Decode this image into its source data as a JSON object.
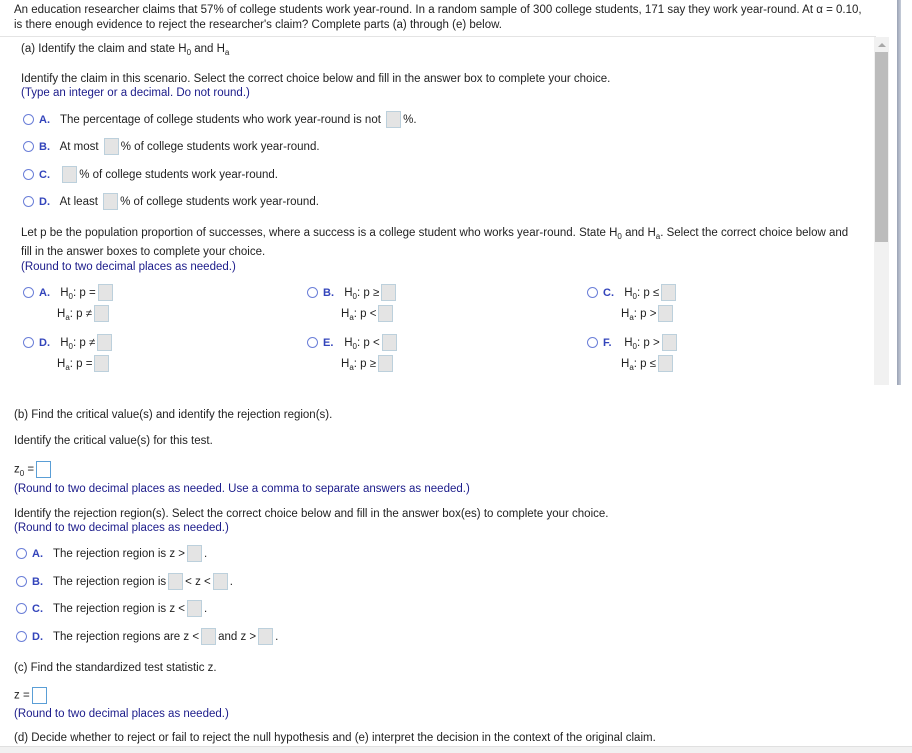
{
  "question": {
    "text": "An education researcher claims that 57% of college students work year-round. In a random sample of 300 college students, 171 say they work year-round. At α = 0.10, is there enough evidence to reject the researcher's claim? Complete parts (a) through (e) below."
  },
  "part_a": {
    "heading_prefix": "(a) Identify the claim and state H",
    "heading_sub0": "0",
    "heading_and": " and H",
    "heading_suba": "a",
    "instruction": "Identify the claim in this scenario. Select the correct choice below and fill in the answer box to complete your choice.",
    "hint": "(Type an integer or a decimal. Do not round.)",
    "claim_choices": [
      {
        "letter": "A.",
        "before": "The percentage of college students who work year-round is not",
        "after": "%."
      },
      {
        "letter": "B.",
        "before": "At most",
        "after": "% of college students work year-round."
      },
      {
        "letter": "C.",
        "before": "",
        "after": "% of college students work year-round."
      },
      {
        "letter": "D.",
        "before": "At least",
        "after": "% of college students work year-round."
      }
    ],
    "hyp_instruction_1": "Let p be the population proportion of successes, where a success is a college student who works year-round. State H",
    "hyp_instruction_sub0": "0",
    "hyp_instruction_and": " and H",
    "hyp_instruction_suba": "a",
    "hyp_instruction_2": ". Select the correct choice below and",
    "hyp_instruction_3": "fill in the answer boxes to complete your choice.",
    "hyp_hint": "(Round to two decimal places as needed.)",
    "hyp_choices": [
      {
        "letter": "A.",
        "h0_op": "p =",
        "ha_op": "p ≠"
      },
      {
        "letter": "B.",
        "h0_op": "p ≥",
        "ha_op": "p <"
      },
      {
        "letter": "C.",
        "h0_op": "p ≤",
        "ha_op": "p >"
      },
      {
        "letter": "D.",
        "h0_op": "p ≠",
        "ha_op": "p ="
      },
      {
        "letter": "E.",
        "h0_op": "p <",
        "ha_op": "p ≥"
      },
      {
        "letter": "F.",
        "h0_op": "p >",
        "ha_op": "p ≤"
      }
    ],
    "h_label": "H",
    "sub0": "0",
    "suba": "a",
    "colon": ":"
  },
  "part_b": {
    "heading": "(b) Find the critical value(s) and identify the rejection region(s).",
    "instruction": "Identify the critical value(s) for this test.",
    "z0_label": "z",
    "z0_sub": "0",
    "z0_eq": " =",
    "z0_hint": "(Round to two decimal places as needed. Use a comma to separate answers as needed.)",
    "region_instruction": "Identify the rejection region(s). Select the correct choice below and fill in the answer box(es) to complete your choice.",
    "region_hint": "(Round to two decimal places as needed.)",
    "region_choices": [
      {
        "letter": "A.",
        "t1": "The rejection region is z >",
        "t2": ".",
        "t3": ""
      },
      {
        "letter": "B.",
        "t1": "The rejection region is",
        "t2": "< z <",
        "t3": "."
      },
      {
        "letter": "C.",
        "t1": "The rejection region is z <",
        "t2": ".",
        "t3": ""
      },
      {
        "letter": "D.",
        "t1": "The rejection regions are z <",
        "t2": "and z >",
        "t3": "."
      }
    ]
  },
  "part_c": {
    "heading": "(c) Find the standardized test statistic z.",
    "z_label": "z =",
    "hint": "(Round to two decimal places as needed.)"
  },
  "part_de": {
    "heading": "(d) Decide whether to reject or fail to reject the null hypothesis and (e) interpret the decision in the context of the original claim."
  }
}
